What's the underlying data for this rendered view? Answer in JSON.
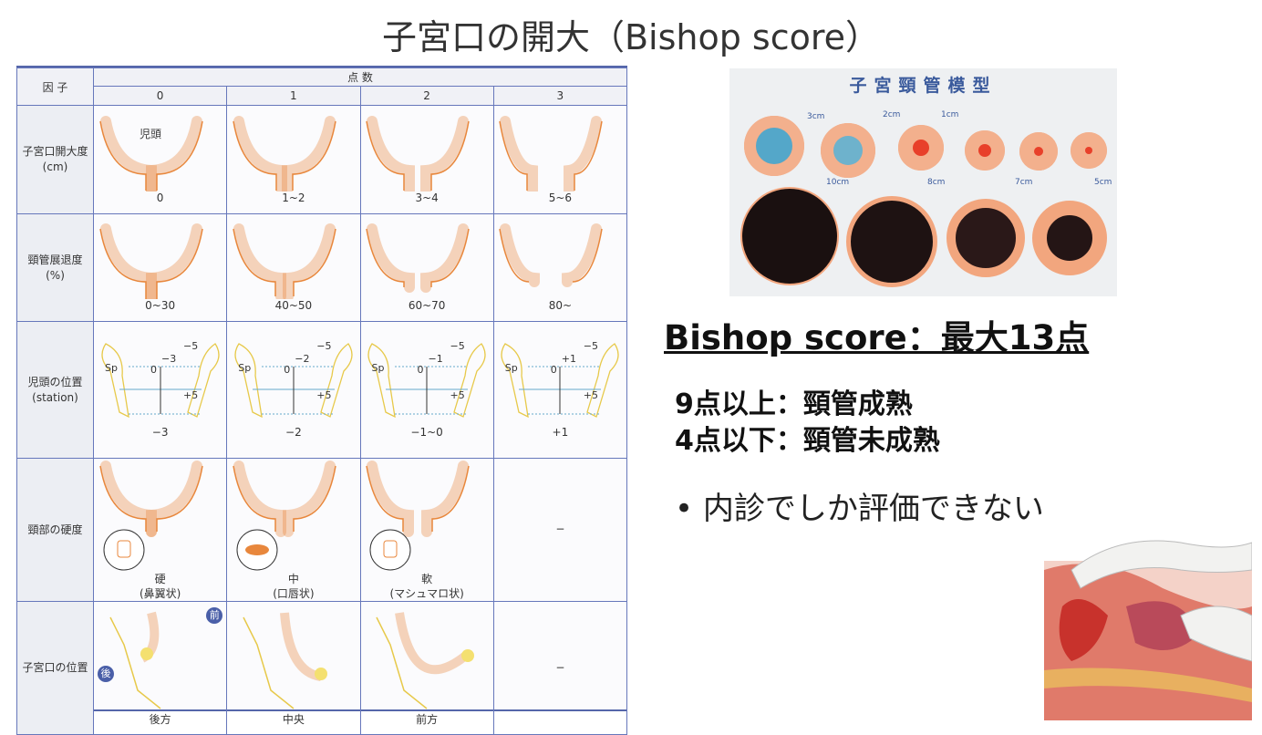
{
  "title": "子宮口の開大（Bishop score）",
  "table": {
    "factor_header": "因 子",
    "score_header": "点 数",
    "scores": [
      "0",
      "1",
      "2",
      "3"
    ],
    "rows": [
      {
        "factor": "子宮口開大度",
        "unit": "(cm)",
        "type": "dilation",
        "cells": [
          {
            "label": "0",
            "note": "児頭"
          },
          {
            "label": "1~2"
          },
          {
            "label": "3~4"
          },
          {
            "label": "5~6"
          }
        ]
      },
      {
        "factor": "頸管展退度",
        "unit": "(%)",
        "type": "effacement",
        "cells": [
          {
            "label": "0~30"
          },
          {
            "label": "40~50"
          },
          {
            "label": "60~70"
          },
          {
            "label": "80~"
          }
        ]
      },
      {
        "factor": "児頭の位置",
        "unit": "(station)",
        "type": "station",
        "cells": [
          {
            "label": "−3",
            "mark": "−3"
          },
          {
            "label": "−2",
            "mark": "−2"
          },
          {
            "label": "−1~0",
            "mark": "−1"
          },
          {
            "label": "+1",
            "mark": "+1"
          }
        ],
        "station_labels": {
          "sp": "Sp",
          "zero": "0",
          "top": "−5",
          "bottom": "+5"
        }
      },
      {
        "factor": "頸部の硬度",
        "unit": "",
        "type": "consistency",
        "cells": [
          {
            "label": "硬",
            "sub": "(鼻翼状)"
          },
          {
            "label": "中",
            "sub": "(口唇状)"
          },
          {
            "label": "軟",
            "sub": "(マシュマロ状)"
          },
          {
            "label": "−"
          }
        ]
      },
      {
        "factor": "子宮口の位置",
        "unit": "",
        "type": "position",
        "cells": [
          {
            "label": "後方",
            "badge_front": "前",
            "badge_back": "後"
          },
          {
            "label": "中央"
          },
          {
            "label": "前方"
          },
          {
            "label": "−"
          }
        ]
      }
    ]
  },
  "photo": {
    "title": "子宮頸管模型",
    "sizes_top": [
      "3cm",
      "2cm",
      "1cm"
    ],
    "sizes_bottom": [
      "10cm",
      "8cm",
      "7cm",
      "5cm"
    ]
  },
  "bishop_title": "Bishop score：最大13点",
  "criteria": [
    "9点以上：頸管成熟",
    "4点以下：頸管未成熟"
  ],
  "bullet": "• 内診でしか評価できない",
  "colors": {
    "orange": "#e8873c",
    "pink": "#fbe3d6",
    "yellow": "#e7c94a",
    "blue": "#3a5a9c"
  }
}
